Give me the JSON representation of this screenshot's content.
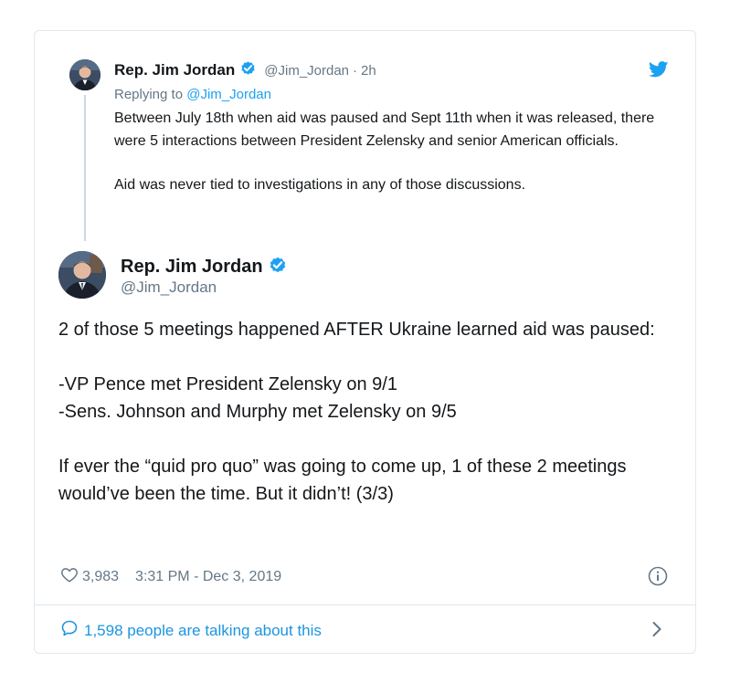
{
  "parent_tweet": {
    "name": "Rep. Jim Jordan",
    "handle": "@Jim_Jordan",
    "separator": "·",
    "time": "2h",
    "replying_prefix": "Replying to ",
    "replying_handle": "@Jim_Jordan",
    "paragraphs": [
      "Between July 18th when aid was paused and Sept 11th when it was released, there were 5 interactions between President Zelensky and senior American officials.",
      "Aid was never tied to investigations in any of those discussions."
    ]
  },
  "main_tweet": {
    "name": "Rep. Jim Jordan",
    "handle": "@Jim_Jordan",
    "paragraphs": [
      "2 of those 5 meetings happened AFTER Ukraine learned aid was paused:",
      "-VP Pence met President Zelensky on 9/1",
      "-Sens. Johnson and Murphy met Zelensky on 9/5",
      "If ever the “quid pro quo” was going to come up, 1 of these 2 meetings would’ve been the time. But it didn’t! (3/3)"
    ],
    "likes": "3,983",
    "timestamp": "3:31 PM - Dec 3, 2019"
  },
  "footer": {
    "talking": "1,598 people are talking about this"
  },
  "colors": {
    "twitter_blue": "#1da1f2",
    "link_blue": "#1b95e0",
    "muted_gray": "#657786",
    "border": "#e1e8ed"
  },
  "icons": [
    "verified-badge-icon",
    "twitter-bird-icon",
    "heart-icon",
    "info-icon",
    "speech-bubble-icon",
    "chevron-right-icon"
  ]
}
